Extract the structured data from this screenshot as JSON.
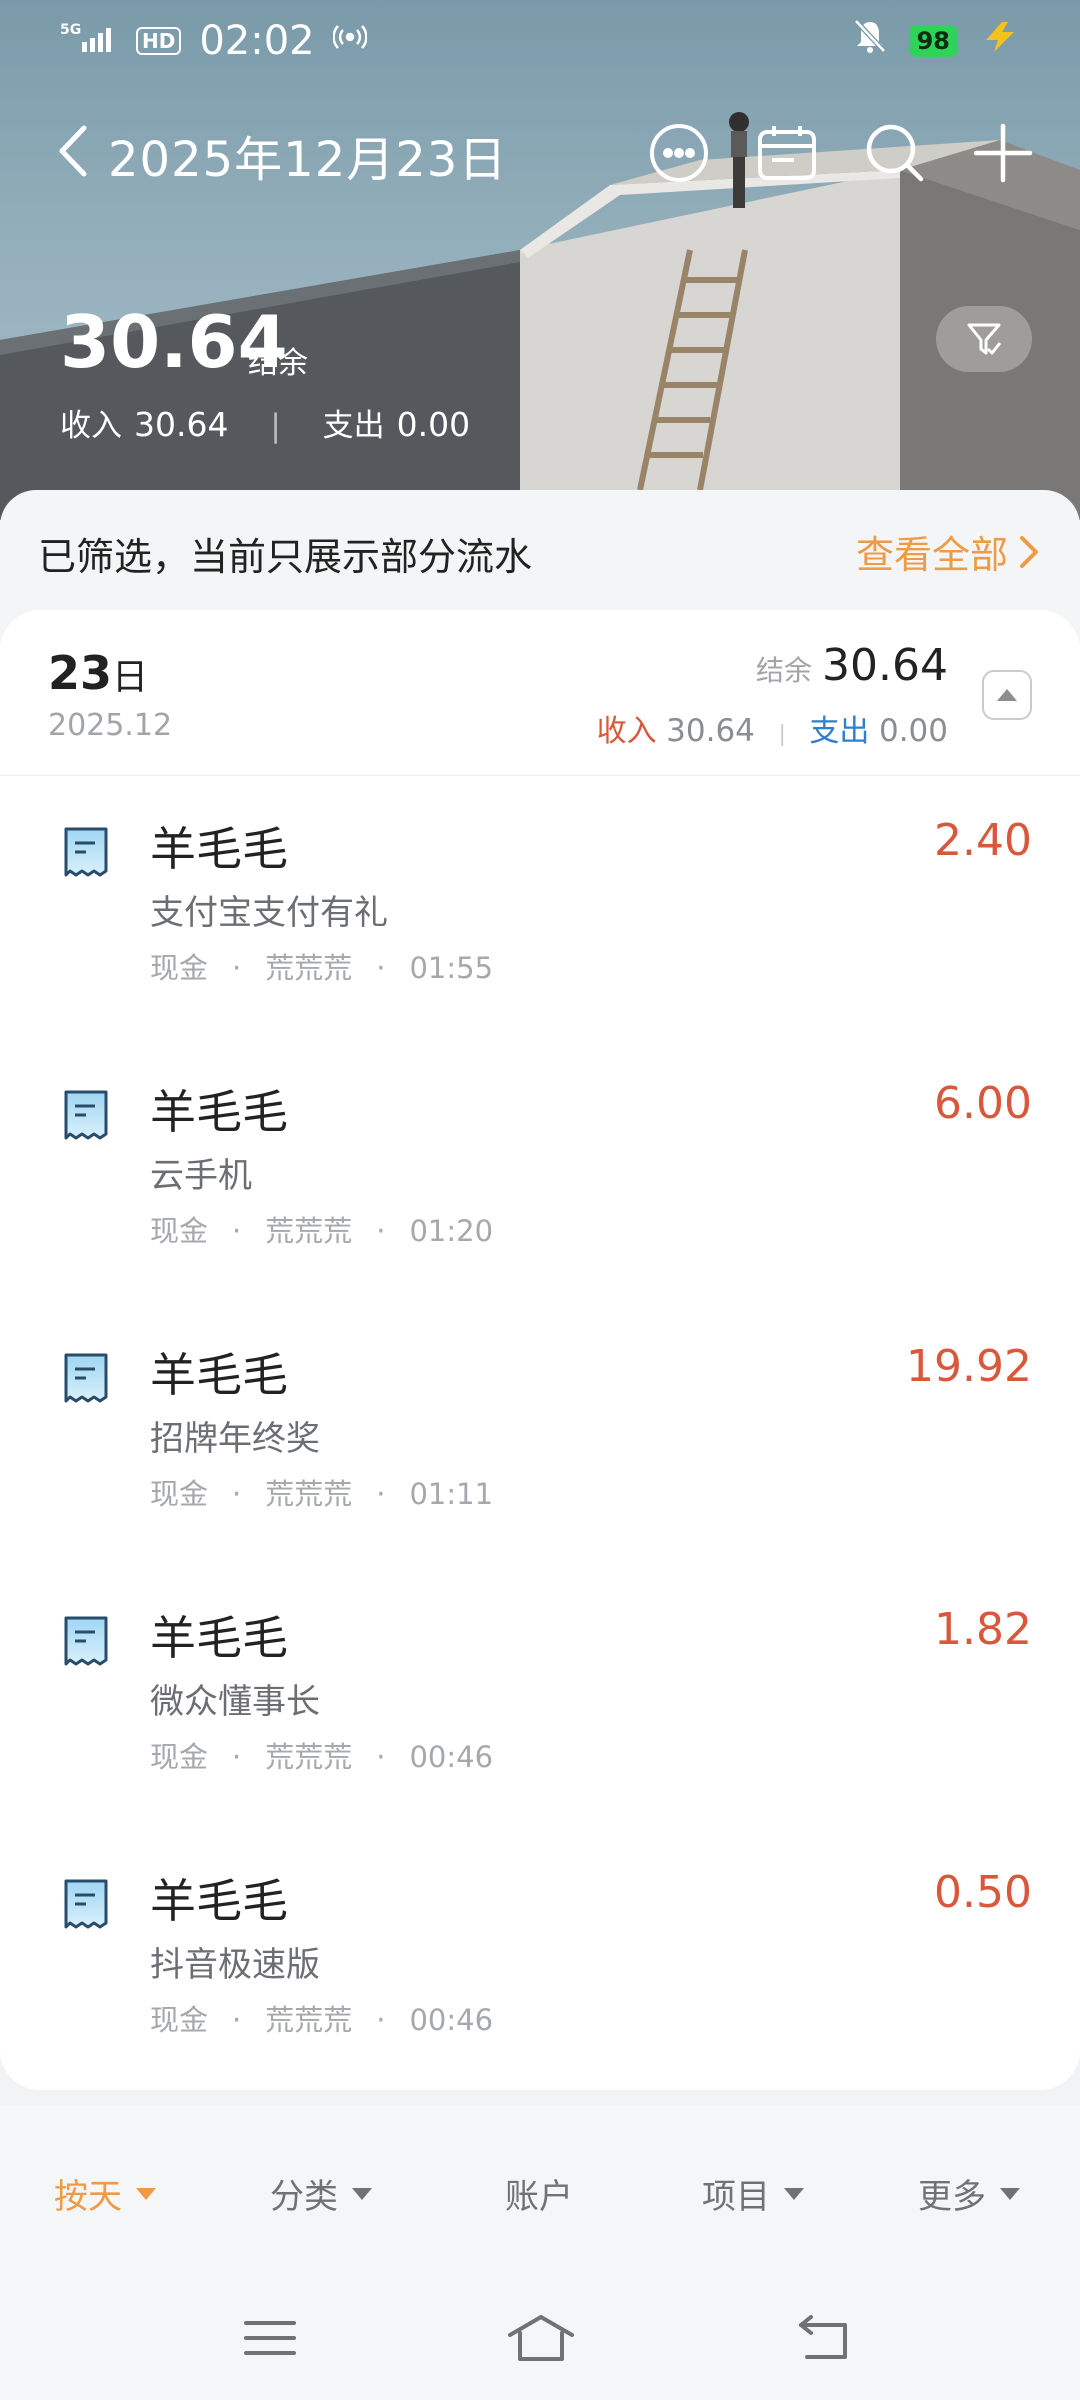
{
  "status_bar": {
    "network": "5G",
    "hd": "HD",
    "time": "02:02",
    "battery": "98"
  },
  "header": {
    "title": "2025年12月23日",
    "balance": "30.64",
    "balance_label": "结余",
    "income_label": "收入",
    "income": "30.64",
    "expense_label": "支出",
    "expense": "0.00"
  },
  "notice": {
    "text": "已筛选，当前只展示部分流水",
    "link": "查看全部"
  },
  "day": {
    "day": "23",
    "day_suffix": "日",
    "year_month": "2025.12",
    "balance_label": "结余",
    "balance": "30.64",
    "income_label": "收入",
    "income": "30.64",
    "expense_label": "支出",
    "expense": "0.00"
  },
  "transactions": [
    {
      "title": "羊毛毛",
      "note": "支付宝支付有礼",
      "account": "现金",
      "member": "荒荒荒",
      "time": "01:55",
      "amount": "2.40"
    },
    {
      "title": "羊毛毛",
      "note": "云手机",
      "account": "现金",
      "member": "荒荒荒",
      "time": "01:20",
      "amount": "6.00"
    },
    {
      "title": "羊毛毛",
      "note": "招牌年终奖",
      "account": "现金",
      "member": "荒荒荒",
      "time": "01:11",
      "amount": "19.92"
    },
    {
      "title": "羊毛毛",
      "note": "微众懂事长",
      "account": "现金",
      "member": "荒荒荒",
      "time": "00:46",
      "amount": "1.82"
    },
    {
      "title": "羊毛毛",
      "note": "抖音极速版",
      "account": "现金",
      "member": "荒荒荒",
      "time": "00:46",
      "amount": "0.50"
    }
  ],
  "tabs": [
    {
      "label": "按天"
    },
    {
      "label": "分类"
    },
    {
      "label": "账户"
    },
    {
      "label": "项目"
    },
    {
      "label": "更多"
    }
  ],
  "colors": {
    "accent": "#ee9a46",
    "income_red": "#d9573a",
    "expense_blue": "#2f7fcf"
  },
  "meta_separator": "·"
}
